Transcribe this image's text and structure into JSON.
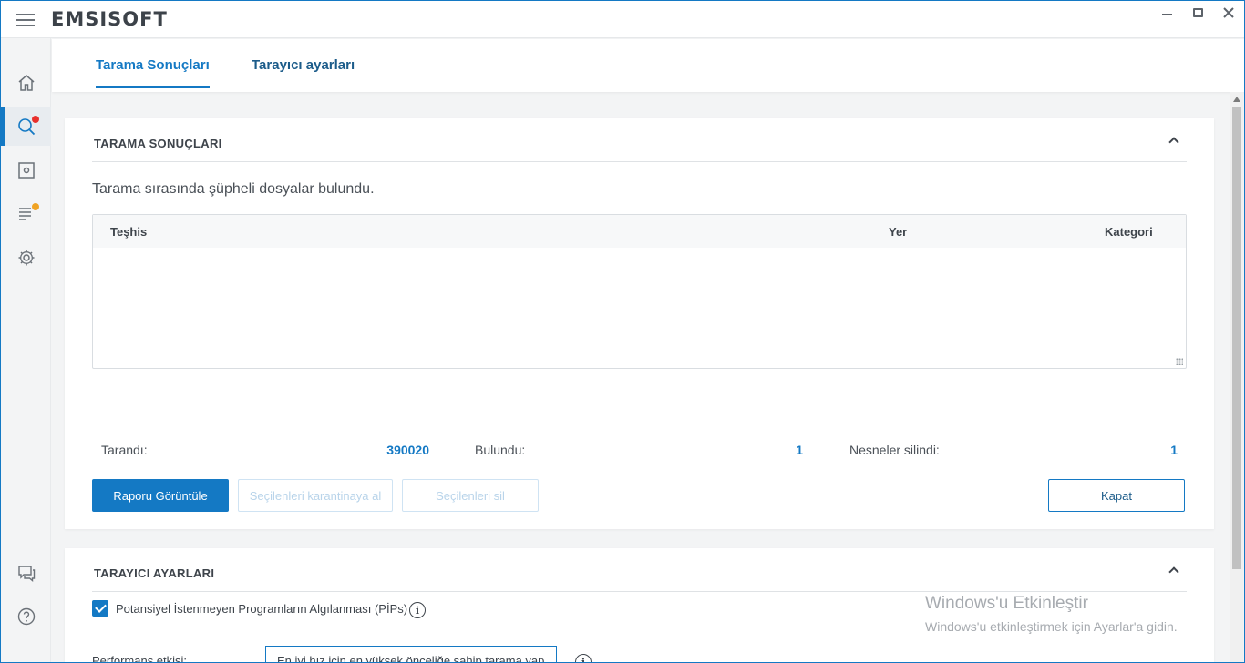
{
  "app": {
    "logo": "EMSISOFT",
    "accent": "#1479c4"
  },
  "rail": {
    "items": [
      {
        "icon": "home-icon"
      },
      {
        "icon": "search-icon",
        "badge": "#e8302c"
      },
      {
        "icon": "quarantine-icon"
      },
      {
        "icon": "logs-icon",
        "badge": "#f0a323"
      },
      {
        "icon": "gear-icon"
      }
    ],
    "bottom": [
      {
        "icon": "chat-icon"
      },
      {
        "icon": "help-icon"
      }
    ]
  },
  "tabs": [
    {
      "label": "Tarama Sonuçları",
      "active": true
    },
    {
      "label": "Tarayıcı ayarları",
      "active": false
    }
  ],
  "results": {
    "header": "TARAMA SONUÇLARI",
    "intro": "Tarama sırasında şüpheli dosyalar bulundu.",
    "columns": [
      "Teşhis",
      "Yer",
      "Kategori"
    ],
    "stats": [
      {
        "label": "Tarandı:",
        "value": "390020"
      },
      {
        "label": "Bulundu:",
        "value": "1"
      },
      {
        "label": "Nesneler silindi:",
        "value": "1"
      }
    ],
    "buttons": {
      "view_report": "Raporu Görüntüle",
      "quarantine_selected": "Seçilenleri karantinaya al",
      "delete_selected": "Seçilenleri sil",
      "close": "Kapat"
    }
  },
  "scanner": {
    "header": "TARAYICI AYARLARI",
    "pip_label": "Potansiyel İstenmeyen Programların Algılanması (PİPs)",
    "pip_checked": true,
    "perf_label": "Performans etkisi:",
    "perf_value": "En iyi hız için en yüksek önceliğe sahip tarama yap"
  },
  "watermark": {
    "title": "Windows'u Etkinleştir",
    "subtitle": "Windows'u etkinleştirmek için Ayarlar'a gidin."
  }
}
